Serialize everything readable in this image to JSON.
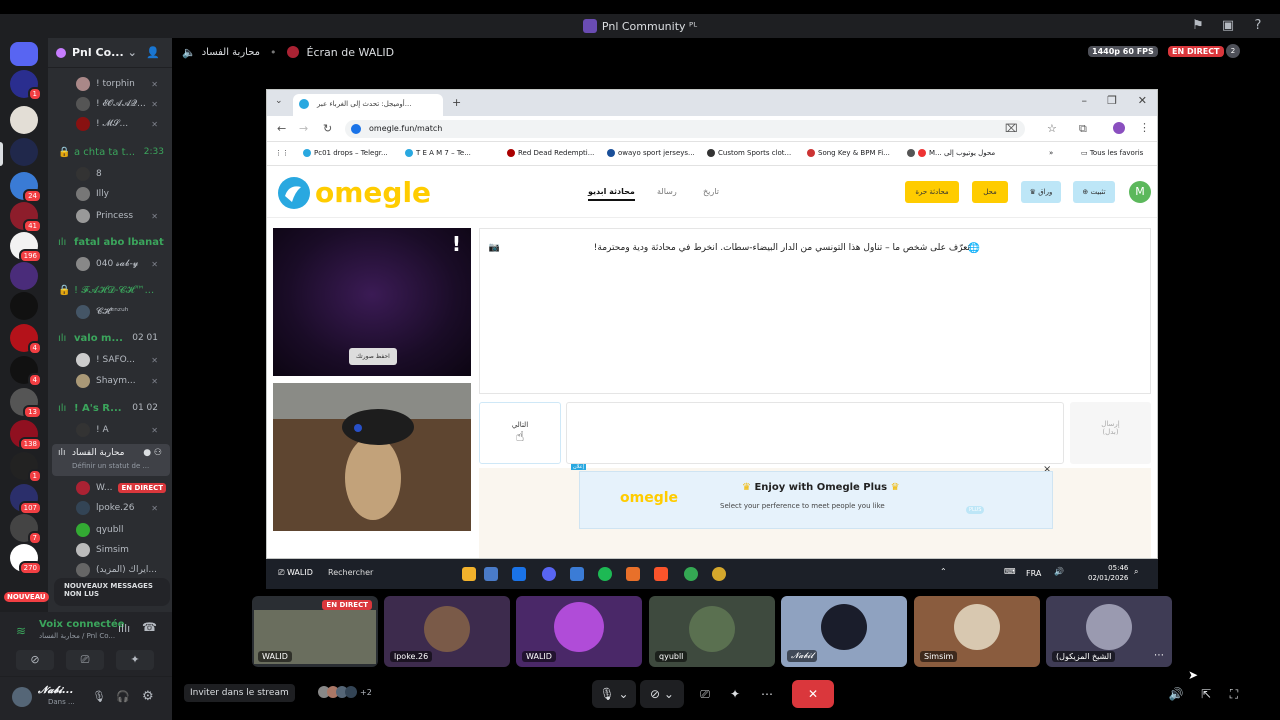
{
  "window": {
    "title": "Pnl Community ᴾᴸ"
  },
  "server": {
    "name": "Pnl Co..."
  },
  "channels": [
    {
      "name": "a chta ta t...",
      "time": "2:33"
    },
    {
      "name": "fatal abo lbanat"
    },
    {
      "name": "! 𝓕𝓐𝓗𝓓-𝓒𝓗™..."
    },
    {
      "name": "valo m...",
      "count_a": "02",
      "count_b": "01"
    },
    {
      "name": "! A's R...",
      "count_a": "01",
      "count_b": "02"
    },
    {
      "name": "محاربة الفساد",
      "status": "Définir un statut de ..."
    }
  ],
  "users": {
    "u1": "! torphin",
    "u2": "! 𝓔𝓞𝓐𝓐𝓠...",
    "u3": "! 𝓜𝓢...",
    "u4": "8",
    "u5": "Illy",
    "u6": "Princess",
    "u7": "040 𝓼𝓪𝓫-𝔂",
    "u8": "𝓒𝓗ᵉⁿᶻᵘʰ",
    "u9": "! SAFO...",
    "u10": "Shaym...",
    "u11": "! A",
    "u12": "W...",
    "u12_badge": "EN DIRECT",
    "u13": "lpoke.26",
    "u14": "qyubll",
    "u15": "Simsim",
    "u16": "ايراك (المزيد)..."
  },
  "new_messages": {
    "label": "NOUVEAUX MESSAGES NON LUS",
    "badge": "NOUVEAU"
  },
  "voice": {
    "title": "Voix connectée",
    "subtitle": "محاربة الفساد / Pnl Co..."
  },
  "user_panel": {
    "name": "𝓝𝓪𝓫𝓲...",
    "status": "Dans ..."
  },
  "stream_header": {
    "channel": "محاربة الفساد",
    "title": "Écran de WALID",
    "quality": "1440p 60 FPS",
    "live": "EN DIRECT",
    "viewers": "2"
  },
  "browser": {
    "tab_title": "أوميجل: تحدث إلى الغرباء عبر...",
    "url": "omegle.fun/match",
    "bookmarks": [
      "Pc01 drops – Telegr...",
      "T E A M 7 – Te...",
      "Red Dead Redempti...",
      "owayo sport jerseys...",
      "Custom Sports clot...",
      "Song Key & BPM Fi...",
      "M... محول يوتيوب إلى",
      "Tous les favoris"
    ]
  },
  "omegle": {
    "logo": "omegle",
    "nav": {
      "video": "محادثة ابديو",
      "text": "رسالة",
      "history": "تاريخ"
    },
    "buttons": {
      "free": "محادثة حرة",
      "gender": "محل",
      "vip": "وراق",
      "apps": "تثبيت"
    },
    "avatar_letter": "M",
    "report": "!",
    "save_btn": "احفظ صورتك",
    "chat_message": "تعرّف على شخص ما – تناول هذا التونسي من الدار البيضاء-سطات. انخرط في محادثة ودية ومحترمة!",
    "next_label": "التالي",
    "send_label": "إرسال",
    "send_sub": "(بدل)",
    "ad": {
      "tag": "إعلان",
      "close": "×",
      "title": "Enjoy with Omegle Plus",
      "subtitle": "Select your perference to meet people you like",
      "plus": "PLUS",
      "logo": "omegle"
    }
  },
  "taskbar": {
    "user": "WALID",
    "search": "Rechercher",
    "lang": "FRA",
    "time": "05:46",
    "date": "02/01/2026"
  },
  "tiles": [
    {
      "name": "WALID",
      "live": "EN DIRECT"
    },
    {
      "name": "lpoke.26"
    },
    {
      "name": "WALID"
    },
    {
      "name": "qyubll"
    },
    {
      "name": "𝓝𝓪𝓫𝓲𝓵"
    },
    {
      "name": "Simsim"
    },
    {
      "name": "(الشيخ المزيكول"
    }
  ],
  "bottom": {
    "invite": "Inviter dans le stream",
    "participants_more": "+2"
  },
  "colors": {
    "green": "#3ba55c",
    "red": "#da373c",
    "omegle_yellow": "#ffcc00",
    "omegle_blue": "#29a8e0"
  }
}
